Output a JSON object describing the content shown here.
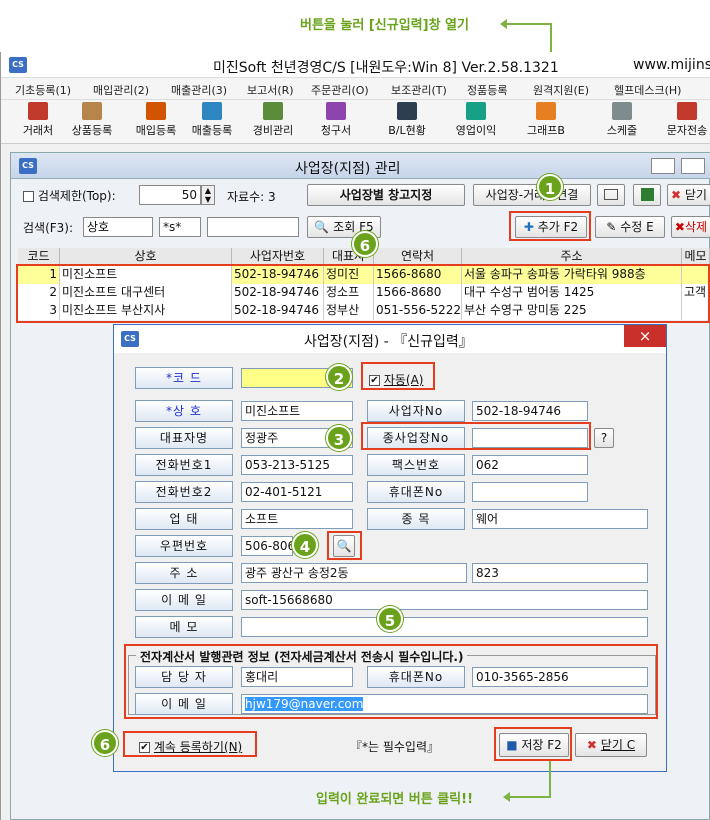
{
  "callouts": {
    "top": "버튼을 눌러 [신규입력]창 열기",
    "bottom": "입력이 완료되면 버튼 클릭!!"
  },
  "markers": [
    "1",
    "2",
    "3",
    "4",
    "5",
    "6",
    "6"
  ],
  "app": {
    "logo": "CS",
    "title": "미진Soft 천년경영C/S [내원도우:Win 8] Ver.2.58.1321",
    "url": "www.mijinsoft"
  },
  "menu": [
    "기초등록(1)",
    "매입관리(2)",
    "매출관리(3)",
    "보고서(R)",
    "주문관리(O)",
    "보조관리(T)",
    "정품등록",
    "원격지원(E)",
    "헬프데스크(H)"
  ],
  "toolbar": [
    "거래처",
    "상품등록",
    "매입등록",
    "매출등록",
    "경비관리",
    "청구서",
    "B/L현황",
    "영업이익",
    "그래프B",
    "스케줄",
    "문자전송"
  ],
  "sub": {
    "title": "사업장(지점) 관리",
    "limit_label": "검색제한(Top):",
    "limit_value": "50",
    "count_label": "자료수: 3",
    "warehouse_btn": "사업장별 창고지정",
    "link_btn": "사업장-거래처연결",
    "close_btn": "닫기",
    "search_label": "검색(F3):",
    "search_field": "상호",
    "search_op": "*s*",
    "search_btn": "조회 F5",
    "add_btn": "추가 F2",
    "edit_btn": "수정 E",
    "del_btn": "삭제"
  },
  "grid": {
    "headers": [
      "코드",
      "상호",
      "사업자번호",
      "대표자",
      "연락처",
      "주소",
      "메모"
    ],
    "rows": [
      [
        "1",
        "미진소프트",
        "502-18-94746",
        "정미진",
        "1566-8680",
        "서울 송파구 송파동 가락타워 988층",
        ""
      ],
      [
        "2",
        "미진소프트 대구센터",
        "502-18-94746",
        "정소프",
        "1566-8680",
        "대구 수성구 범어동 1425",
        "고객"
      ],
      [
        "3",
        "미진소프트 부산지사",
        "502-18-94746",
        "정부산",
        "051-556-5222",
        "부산 수영구 망미동 225",
        ""
      ]
    ]
  },
  "dialog": {
    "title": "사업장(지점) - 『신규입력』",
    "close": "×",
    "auto_label": "자동(A)",
    "fields": {
      "code": {
        "label": "*코   드",
        "value": ""
      },
      "name": {
        "label": "*상   호",
        "value": "미진소프트"
      },
      "bizno": {
        "label": "사업자No",
        "value": "502-18-94746"
      },
      "ceo": {
        "label": "대표자명",
        "value": "정광주"
      },
      "subbiz": {
        "label": "종사업장No",
        "value": ""
      },
      "tel1": {
        "label": "전화번호1",
        "value": "053-213-5125"
      },
      "fax": {
        "label": "팩스번호",
        "value": "062"
      },
      "tel2": {
        "label": "전화번호2",
        "value": "02-401-5121"
      },
      "mobile": {
        "label": "휴대폰No",
        "value": ""
      },
      "biztype": {
        "label": "업   태",
        "value": "소프트"
      },
      "item": {
        "label": "종   목",
        "value": "웨어"
      },
      "zip": {
        "label": "우편번호",
        "value": "506-806"
      },
      "addr": {
        "label": "주   소",
        "value": "광주 광산구 송정2동",
        "value2": "823"
      },
      "email": {
        "label": "이 메 일",
        "value": "soft-15668680"
      },
      "memo": {
        "label": "메   모",
        "value": ""
      }
    },
    "tax_legend": "전자계산서 발행관련 정보 (전자세금계산서 전송시 필수입니다.)",
    "tax": {
      "manager": {
        "label": "담 당 자",
        "value": "홍대리"
      },
      "mobile": {
        "label": "휴대폰No",
        "value": "010-3565-2856"
      },
      "email": {
        "label": "이 메 일",
        "value": "hjw179@naver.com"
      }
    },
    "continue_label": "계속 등록하기(N)",
    "required_note": "『*는 필수입력』",
    "save_btn": "저장 F2",
    "close_btn": "닫기 C",
    "question": "?"
  },
  "colors": {
    "accent": "#6aa31b",
    "highlight": "#e53e1e",
    "yellow": "#ffff88",
    "selection": "#3399ff"
  }
}
